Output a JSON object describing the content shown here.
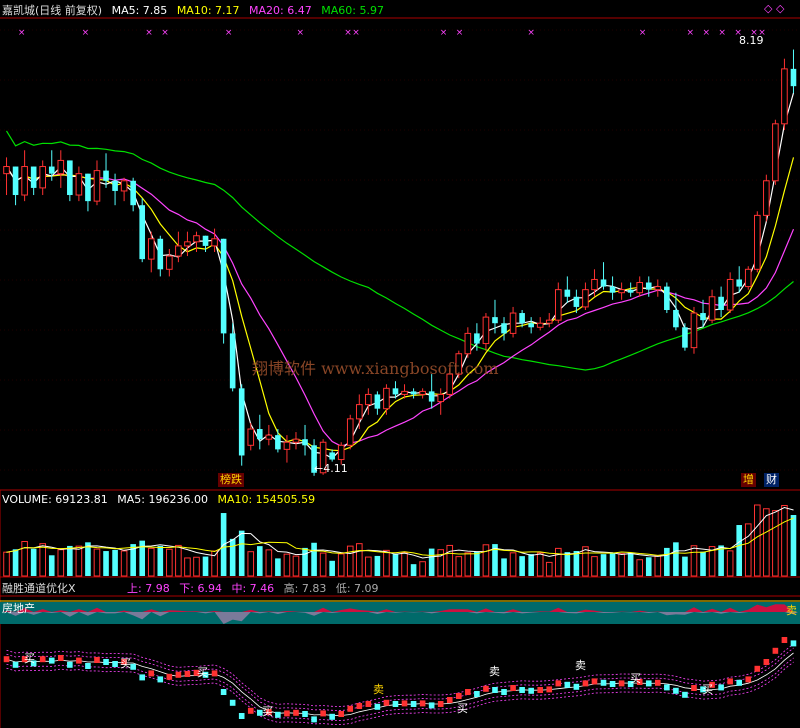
{
  "colors": {
    "background": "#000000",
    "up": "#ff3232",
    "down": "#54ffff",
    "ma5": "#ffffff",
    "ma10": "#ffff00",
    "ma20": "#ff44ff",
    "ma60": "#00e000",
    "grid": "#aa0000"
  },
  "main_panel": {
    "stock_label": "嘉凯城(日线 前复权)",
    "ma5_label": "MA5: 7.85",
    "ma10_label": "MA10: 7.17",
    "ma20_label": "MA20: 6.47",
    "ma60_label": "MA60: 5.97",
    "high_marker": "8.19",
    "low_marker": "←4.11",
    "watermark": "翔博软件 www.xiangbosoft.com",
    "tag_left": "榜跌",
    "tag_right_1": "增",
    "tag_right_2": "财"
  },
  "volume_panel": {
    "volume_label": "VOLUME: 69123.81",
    "ma5_label": "MA5: 196236.00",
    "ma10_label": "MA10: 154505.59"
  },
  "indicator_panel": {
    "name": "融胜通道优化X",
    "up_label": "上: 7.98",
    "down_label": "下: 6.94",
    "mid_label": "中: 7.46",
    "high_label": "高: 7.83",
    "low_label": "低: 7.09",
    "sector_label": "房地产",
    "buy_label": "买",
    "sell_label": "卖"
  },
  "chart_data": {
    "type": "candlestick",
    "price_axis": {
      "range": [
        3.9,
        8.5
      ]
    },
    "candles": [
      {
        "o": 6.97,
        "h": 7.13,
        "l": 6.76,
        "c": 7.04
      },
      {
        "o": 7.04,
        "h": 7.04,
        "l": 6.66,
        "c": 6.76
      },
      {
        "o": 6.76,
        "h": 7.2,
        "l": 6.7,
        "c": 7.04
      },
      {
        "o": 7.04,
        "h": 7.04,
        "l": 6.76,
        "c": 6.83
      },
      {
        "o": 6.83,
        "h": 7.1,
        "l": 6.76,
        "c": 7.04
      },
      {
        "o": 7.04,
        "h": 7.2,
        "l": 6.9,
        "c": 6.97
      },
      {
        "o": 6.97,
        "h": 7.2,
        "l": 6.83,
        "c": 7.1
      },
      {
        "o": 7.1,
        "h": 7.1,
        "l": 6.7,
        "c": 6.76
      },
      {
        "o": 6.76,
        "h": 7.04,
        "l": 6.7,
        "c": 6.97
      },
      {
        "o": 6.97,
        "h": 6.97,
        "l": 6.6,
        "c": 6.7
      },
      {
        "o": 6.7,
        "h": 7.1,
        "l": 6.66,
        "c": 7.0
      },
      {
        "o": 7.0,
        "h": 7.17,
        "l": 6.83,
        "c": 6.9
      },
      {
        "o": 6.9,
        "h": 6.97,
        "l": 6.66,
        "c": 6.8
      },
      {
        "o": 6.8,
        "h": 6.93,
        "l": 6.7,
        "c": 6.9
      },
      {
        "o": 6.9,
        "h": 6.93,
        "l": 6.6,
        "c": 6.66
      },
      {
        "o": 6.66,
        "h": 6.73,
        "l": 6.1,
        "c": 6.13
      },
      {
        "o": 6.13,
        "h": 6.4,
        "l": 6.0,
        "c": 6.33
      },
      {
        "o": 6.33,
        "h": 6.36,
        "l": 5.96,
        "c": 6.03
      },
      {
        "o": 6.03,
        "h": 6.23,
        "l": 5.96,
        "c": 6.16
      },
      {
        "o": 6.16,
        "h": 6.4,
        "l": 6.1,
        "c": 6.26
      },
      {
        "o": 6.26,
        "h": 6.4,
        "l": 6.16,
        "c": 6.3
      },
      {
        "o": 6.3,
        "h": 6.4,
        "l": 6.2,
        "c": 6.36
      },
      {
        "o": 6.36,
        "h": 6.36,
        "l": 6.2,
        "c": 6.26
      },
      {
        "o": 6.26,
        "h": 6.43,
        "l": 6.2,
        "c": 6.33
      },
      {
        "o": 6.33,
        "h": 6.33,
        "l": 5.3,
        "c": 5.4
      },
      {
        "o": 5.4,
        "h": 5.5,
        "l": 4.83,
        "c": 4.86
      },
      {
        "o": 4.86,
        "h": 4.9,
        "l": 4.1,
        "c": 4.2
      },
      {
        "o": 4.3,
        "h": 4.52,
        "l": 4.25,
        "c": 4.46
      },
      {
        "o": 4.46,
        "h": 4.6,
        "l": 4.26,
        "c": 4.36
      },
      {
        "o": 4.36,
        "h": 4.5,
        "l": 4.3,
        "c": 4.4
      },
      {
        "o": 4.4,
        "h": 4.46,
        "l": 4.23,
        "c": 4.26
      },
      {
        "o": 4.26,
        "h": 4.4,
        "l": 4.13,
        "c": 4.33
      },
      {
        "o": 4.33,
        "h": 4.43,
        "l": 4.26,
        "c": 4.36
      },
      {
        "o": 4.36,
        "h": 4.5,
        "l": 4.2,
        "c": 4.3
      },
      {
        "o": 4.3,
        "h": 4.36,
        "l": 4.0,
        "c": 4.03
      },
      {
        "o": 4.03,
        "h": 4.36,
        "l": 4.01,
        "c": 4.33
      },
      {
        "o": 4.23,
        "h": 4.26,
        "l": 4.14,
        "c": 4.16
      },
      {
        "o": 4.16,
        "h": 4.33,
        "l": 4.11,
        "c": 4.3
      },
      {
        "o": 4.3,
        "h": 4.6,
        "l": 4.26,
        "c": 4.56
      },
      {
        "o": 4.56,
        "h": 4.8,
        "l": 4.46,
        "c": 4.7
      },
      {
        "o": 4.7,
        "h": 4.86,
        "l": 4.6,
        "c": 4.8
      },
      {
        "o": 4.8,
        "h": 4.83,
        "l": 4.6,
        "c": 4.66
      },
      {
        "o": 4.66,
        "h": 4.9,
        "l": 4.6,
        "c": 4.86
      },
      {
        "o": 4.86,
        "h": 4.93,
        "l": 4.76,
        "c": 4.8
      },
      {
        "o": 4.8,
        "h": 4.9,
        "l": 4.76,
        "c": 4.83
      },
      {
        "o": 4.83,
        "h": 4.86,
        "l": 4.76,
        "c": 4.8
      },
      {
        "o": 4.8,
        "h": 4.86,
        "l": 4.76,
        "c": 4.83
      },
      {
        "o": 4.83,
        "h": 5.0,
        "l": 4.66,
        "c": 4.73
      },
      {
        "o": 4.73,
        "h": 4.86,
        "l": 4.6,
        "c": 4.8
      },
      {
        "o": 4.8,
        "h": 5.06,
        "l": 4.76,
        "c": 5.0
      },
      {
        "o": 5.0,
        "h": 5.23,
        "l": 4.96,
        "c": 5.2
      },
      {
        "o": 5.2,
        "h": 5.46,
        "l": 5.16,
        "c": 5.4
      },
      {
        "o": 5.4,
        "h": 5.5,
        "l": 5.23,
        "c": 5.3
      },
      {
        "o": 5.3,
        "h": 5.6,
        "l": 5.23,
        "c": 5.56
      },
      {
        "o": 5.56,
        "h": 5.73,
        "l": 5.4,
        "c": 5.5
      },
      {
        "o": 5.5,
        "h": 5.56,
        "l": 5.33,
        "c": 5.4
      },
      {
        "o": 5.4,
        "h": 5.66,
        "l": 5.36,
        "c": 5.6
      },
      {
        "o": 5.6,
        "h": 5.63,
        "l": 5.46,
        "c": 5.5
      },
      {
        "o": 5.5,
        "h": 5.56,
        "l": 5.4,
        "c": 5.46
      },
      {
        "o": 5.46,
        "h": 5.56,
        "l": 5.43,
        "c": 5.5
      },
      {
        "o": 5.5,
        "h": 5.6,
        "l": 5.46,
        "c": 5.53
      },
      {
        "o": 5.53,
        "h": 5.9,
        "l": 5.5,
        "c": 5.83
      },
      {
        "o": 5.83,
        "h": 5.96,
        "l": 5.7,
        "c": 5.76
      },
      {
        "o": 5.76,
        "h": 5.83,
        "l": 5.6,
        "c": 5.66
      },
      {
        "o": 5.66,
        "h": 5.9,
        "l": 5.63,
        "c": 5.83
      },
      {
        "o": 5.83,
        "h": 6.03,
        "l": 5.76,
        "c": 5.93
      },
      {
        "o": 5.93,
        "h": 6.1,
        "l": 5.83,
        "c": 5.86
      },
      {
        "o": 5.86,
        "h": 5.96,
        "l": 5.73,
        "c": 5.8
      },
      {
        "o": 5.8,
        "h": 5.9,
        "l": 5.73,
        "c": 5.83
      },
      {
        "o": 5.83,
        "h": 5.9,
        "l": 5.76,
        "c": 5.8
      },
      {
        "o": 5.8,
        "h": 5.96,
        "l": 5.76,
        "c": 5.9
      },
      {
        "o": 5.9,
        "h": 5.96,
        "l": 5.76,
        "c": 5.83
      },
      {
        "o": 5.83,
        "h": 5.93,
        "l": 5.76,
        "c": 5.86
      },
      {
        "o": 5.86,
        "h": 5.9,
        "l": 5.6,
        "c": 5.63
      },
      {
        "o": 5.63,
        "h": 5.8,
        "l": 5.43,
        "c": 5.46
      },
      {
        "o": 5.46,
        "h": 5.5,
        "l": 5.23,
        "c": 5.26
      },
      {
        "o": 5.26,
        "h": 5.66,
        "l": 5.2,
        "c": 5.6
      },
      {
        "o": 5.6,
        "h": 5.73,
        "l": 5.46,
        "c": 5.53
      },
      {
        "o": 5.53,
        "h": 5.83,
        "l": 5.5,
        "c": 5.76
      },
      {
        "o": 5.76,
        "h": 5.86,
        "l": 5.56,
        "c": 5.63
      },
      {
        "o": 5.63,
        "h": 6.0,
        "l": 5.6,
        "c": 5.93
      },
      {
        "o": 5.93,
        "h": 6.06,
        "l": 5.8,
        "c": 5.86
      },
      {
        "o": 5.86,
        "h": 6.06,
        "l": 5.83,
        "c": 6.03
      },
      {
        "o": 6.03,
        "h": 6.6,
        "l": 6.0,
        "c": 6.56
      },
      {
        "o": 6.56,
        "h": 6.96,
        "l": 6.5,
        "c": 6.9
      },
      {
        "o": 6.9,
        "h": 7.5,
        "l": 6.86,
        "c": 7.46
      },
      {
        "o": 7.46,
        "h": 8.1,
        "l": 7.4,
        "c": 8.0
      },
      {
        "o": 8.0,
        "h": 8.19,
        "l": 7.76,
        "c": 7.83
      }
    ],
    "ma_lines": [
      {
        "name": "MA5",
        "value": 7.85
      },
      {
        "name": "MA10",
        "value": 7.17
      },
      {
        "name": "MA20",
        "value": 6.47
      },
      {
        "name": "MA60",
        "value": 5.97
      }
    ],
    "volume": {
      "last": 69123.81,
      "ma5": 196236.0,
      "ma10": 154505.59
    },
    "channel": {
      "upper": 7.98,
      "lower": 6.94,
      "middle": 7.46,
      "high": 7.83,
      "low": 7.09
    }
  }
}
